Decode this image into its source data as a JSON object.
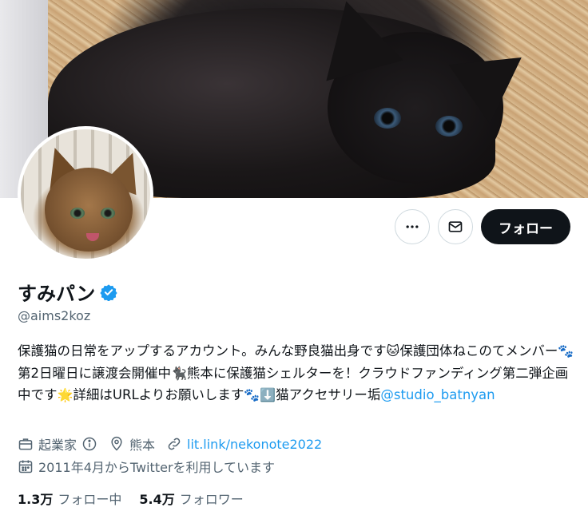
{
  "profile": {
    "name": "すみパン",
    "handle": "@aims2koz",
    "bio": {
      "part1": "保護猫の日常をアップするアカウント。みんな野良猫出身です",
      "emoji1": "🐱",
      "part2": "保護団体ねこのてメンバー",
      "emoji2": "🐾",
      "part3": "第2日曜日に譲渡会開催中",
      "emoji3": "🐈‍⬛",
      "part4": "熊本に保護猫シェルターを！クラウドファンディング第二弾企画中です",
      "emoji4": "🌟",
      "part5": "詳細はURLよりお願いします",
      "emoji5": "🐾",
      "emoji6": "⬇️",
      "part6": "猫アクセサリー垢",
      "mention": "@studio_batnyan"
    },
    "job": "起業家",
    "location": "熊本",
    "website": "lit.link/nekonote2022",
    "joined": "2011年4月からTwitterを利用しています",
    "following_count": "1.3万",
    "following_label": "フォロー中",
    "followers_count": "5.4万",
    "followers_label": "フォロワー"
  },
  "actions": {
    "follow_label": "フォロー",
    "more_icon": "more-icon",
    "message_icon": "mail-icon"
  },
  "colors": {
    "link": "#1d9bf0",
    "primary_button": "#0f1419",
    "secondary_text": "#536471"
  }
}
